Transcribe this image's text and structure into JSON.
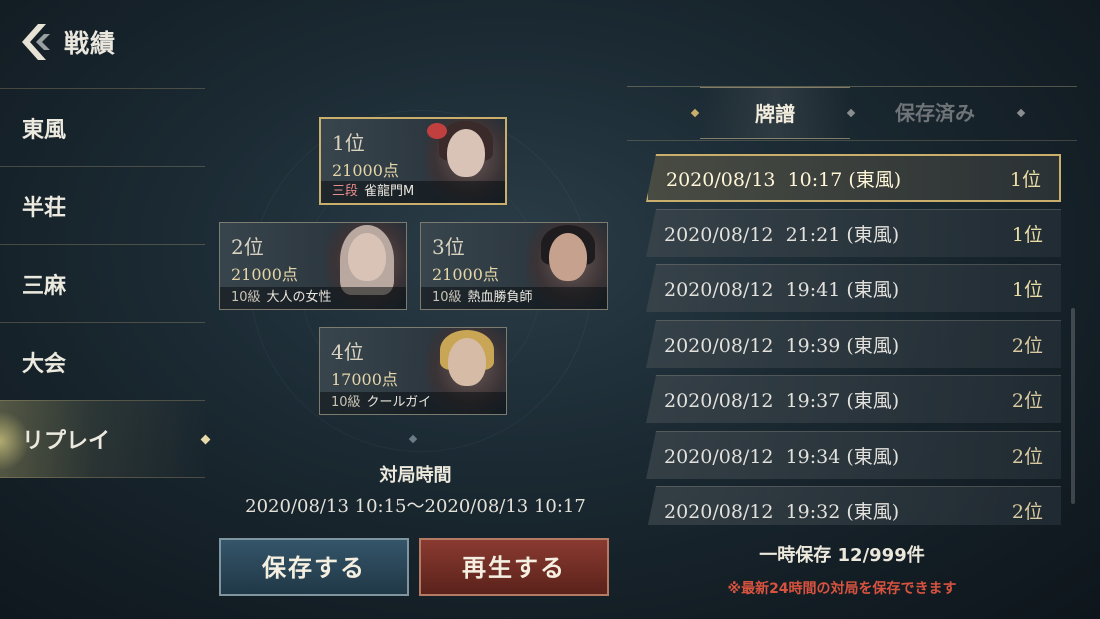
{
  "header": {
    "title": "戦績"
  },
  "menu": [
    {
      "label": "東風"
    },
    {
      "label": "半荘"
    },
    {
      "label": "三麻"
    },
    {
      "label": "大会"
    },
    {
      "label": "リプレイ",
      "active": true
    }
  ],
  "players": [
    {
      "rank": "1位",
      "points": "21000点",
      "level": "三段",
      "name": "雀龍門M"
    },
    {
      "rank": "2位",
      "points": "21000点",
      "level": "10級",
      "name": "大人の女性"
    },
    {
      "rank": "3位",
      "points": "21000点",
      "level": "10級",
      "name": "熱血勝負師"
    },
    {
      "rank": "4位",
      "points": "17000点",
      "level": "10級",
      "name": "クールガイ"
    }
  ],
  "match": {
    "duration_label": "対局時間",
    "duration_value": "2020/08/13  10:15～2020/08/13  10:17"
  },
  "buttons": {
    "save": "保存する",
    "play": "再生する"
  },
  "tabs": {
    "active": "牌譜",
    "inactive": "保存済み"
  },
  "records": [
    {
      "datetime": "2020/08/13  10:17 (東風)",
      "rank": "1位",
      "selected": true
    },
    {
      "datetime": "2020/08/12  21:21 (東風)",
      "rank": "1位"
    },
    {
      "datetime": "2020/08/12  19:41 (東風)",
      "rank": "1位"
    },
    {
      "datetime": "2020/08/12  19:39 (東風)",
      "rank": "2位"
    },
    {
      "datetime": "2020/08/12  19:37 (東風)",
      "rank": "2位"
    },
    {
      "datetime": "2020/08/12  19:34 (東風)",
      "rank": "2位"
    },
    {
      "datetime": "2020/08/12  19:32 (東風)",
      "rank": "2位"
    }
  ],
  "footer": {
    "save_count": "一時保存 12/999件",
    "notice": "※最新24時間の対局を保存できます"
  },
  "colors": {
    "gold": "#c9ae6c",
    "notice_red": "#d8533f",
    "save_blue": "#35556a",
    "play_red": "#8a3a30"
  }
}
